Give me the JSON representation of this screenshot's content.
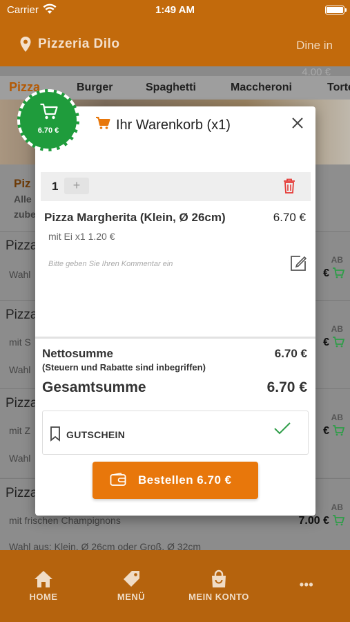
{
  "status_bar": {
    "carrier": "Carrier",
    "time": "1:49 AM"
  },
  "header": {
    "store_name": "Pizzeria Dilo",
    "mode": "Dine in"
  },
  "background": {
    "ghost_price": "4.00 €",
    "categories": [
      "Pizza",
      "Burger",
      "Spaghetti",
      "Maccheroni",
      "Torte"
    ],
    "info": {
      "title": "Piz",
      "line1": "Alle",
      "line2": "zube"
    },
    "items": [
      {
        "name": "Pizza",
        "desc": "",
        "desc2": "Wahl",
        "ab": "AB",
        "price": "€"
      },
      {
        "name": "Pizza",
        "desc": "mit S",
        "desc2": "Wahl",
        "ab": "AB",
        "price": "€"
      },
      {
        "name": "Pizza",
        "desc": "mit Z",
        "desc2": "Wahl",
        "ab": "AB",
        "price": "€"
      },
      {
        "name": "Pizza",
        "desc": "mit frischen Champignons",
        "desc2": "Wahl aus: Klein, Ø 26cm oder Groß, Ø 32cm",
        "ab": "AB",
        "price": "7.00 €"
      }
    ]
  },
  "cart_badge": {
    "amount": "6.70 €"
  },
  "modal": {
    "title": "Ihr Warenkorb (x1)",
    "quantity": "1",
    "plus_label": "+",
    "item": {
      "name": "Pizza Margherita (Klein, Ø 26cm)",
      "price": "6.70 €",
      "extra": "mit Ei x1 1.20 €",
      "comment_placeholder": "Bitte geben Sie Ihren Kommentar ein"
    },
    "net_label": "Nettosumme",
    "net_value": "6.70 €",
    "tax_note": "(Steuern und Rabatte sind inbegriffen)",
    "total_label": "Gesamtsumme",
    "total_value": "6.70 €",
    "voucher_label": "GUTSCHEIN",
    "order_button": "Bestellen 6.70 €"
  },
  "tabbar": {
    "home": "HOME",
    "menu": "MENÜ",
    "account": "MEIN KONTO",
    "more": "•••"
  },
  "colors": {
    "brand": "#c26a0c",
    "order_button": "#e8770b",
    "badge": "#1f9c3c",
    "cart_icon": "#e8770b",
    "trash": "#e53935",
    "check": "#2e9d48"
  }
}
